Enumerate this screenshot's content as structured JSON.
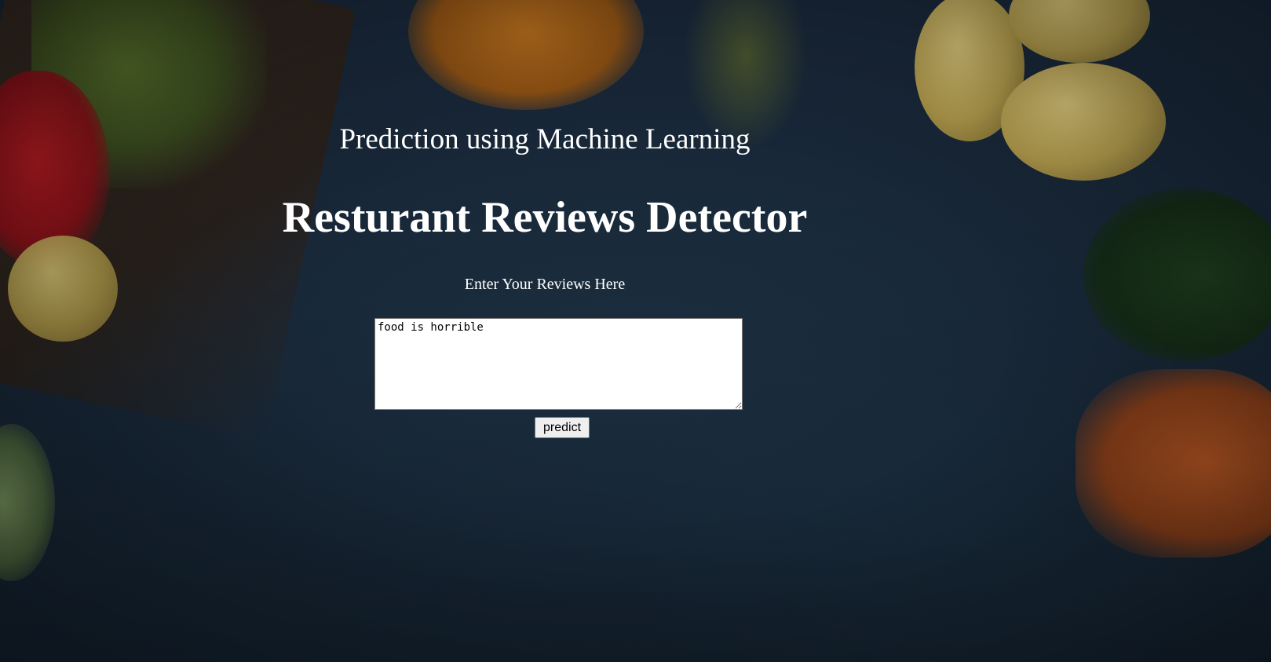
{
  "header": {
    "subtitle": "Prediction using Machine Learning",
    "title": "Resturant Reviews Detector"
  },
  "form": {
    "label": "Enter Your Reviews Here",
    "review_value": "food is horrible",
    "submit_label": "predict"
  },
  "colors": {
    "background": "#16202b",
    "text": "#ffffff",
    "input_background": "#ffffff",
    "button_background": "#efefef"
  }
}
